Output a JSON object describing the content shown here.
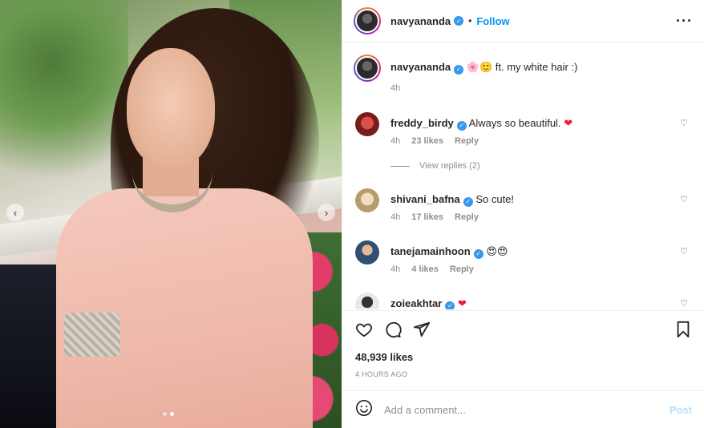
{
  "post": {
    "author": "navyananda",
    "follow_label": "Follow",
    "separator": "•",
    "more_label": "•••",
    "image_dots": 2,
    "active_dot": 1
  },
  "caption": {
    "username": "navyananda",
    "emojis": "🌸🙂",
    "text": "ft. my white hair :)",
    "time": "4h"
  },
  "comments": [
    {
      "username": "freddy_birdy",
      "text": "Always so beautiful.",
      "emoji": "❤",
      "time": "4h",
      "likes": "23 likes",
      "reply": "Reply",
      "avatar_color": "#b7332f"
    },
    {
      "username": "shivani_bafna",
      "text": "So cute!",
      "emoji": "",
      "time": "4h",
      "likes": "17 likes",
      "reply": "Reply",
      "avatar_color": "#d8c6a3"
    },
    {
      "username": "tanejamainhoon",
      "text": "",
      "emoji": "😍😍",
      "time": "4h",
      "likes": "4 likes",
      "reply": "Reply",
      "avatar_color": "#3b5d82"
    },
    {
      "username": "zoieakhtar",
      "text": "",
      "emoji": "❤",
      "time": "",
      "likes": "",
      "reply": "",
      "avatar_color": "#cfcfcf"
    }
  ],
  "view_replies": "View replies (2)",
  "stats": {
    "likes": "48,939 likes",
    "posted": "4 HOURS AGO"
  },
  "composer": {
    "placeholder": "Add a comment...",
    "post_label": "Post"
  },
  "icons": [
    "heart-icon",
    "comment-icon",
    "share-icon",
    "bookmark-icon",
    "emoji-icon",
    "more-icon",
    "verified-icon",
    "chevron-left-icon",
    "chevron-right-icon"
  ]
}
